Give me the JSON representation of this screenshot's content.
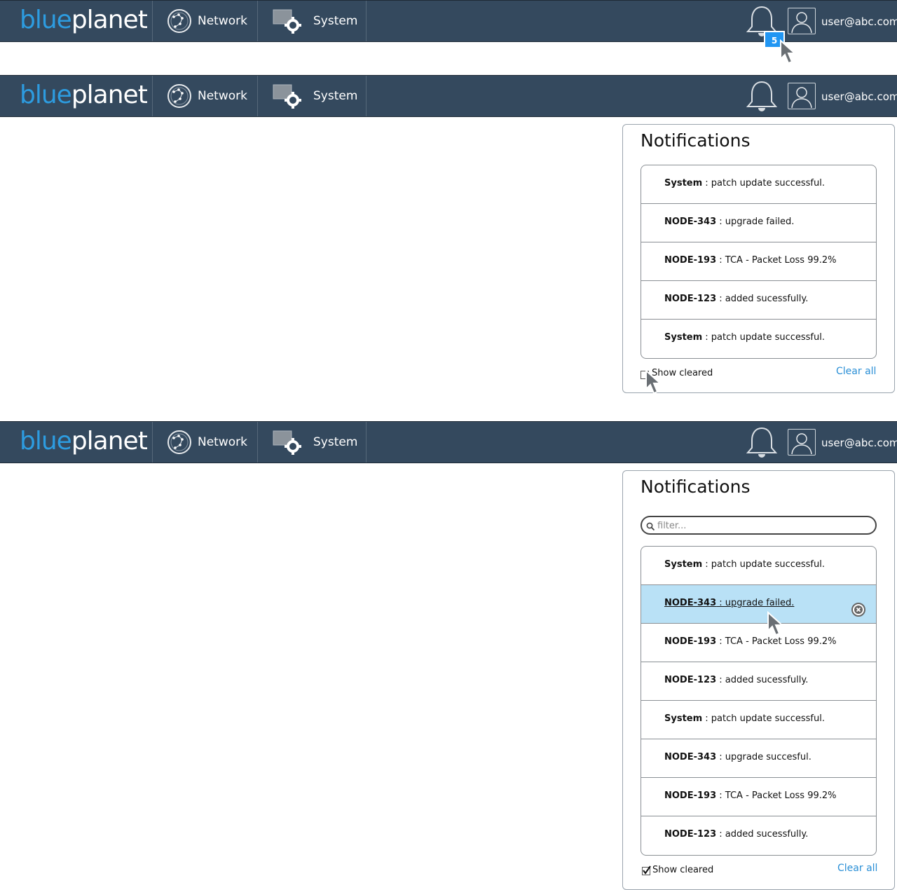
{
  "brand": {
    "part1": "blue",
    "part2": "planet"
  },
  "nav": {
    "network_label": "Network",
    "system_label": "System"
  },
  "user": {
    "email": "user@abc.com"
  },
  "notifications_badge": "5",
  "panel": {
    "title": "Notifications",
    "show_cleared_label": "Show cleared",
    "clear_all_label": "Clear all",
    "filter_placeholder": "filter..."
  },
  "list_short": [
    {
      "source": "System",
      "text": " : patch update successful."
    },
    {
      "source": "NODE-343",
      "text": " : upgrade failed."
    },
    {
      "source": "NODE-193",
      "text": " : TCA - Packet Loss 99.2%"
    },
    {
      "source": "NODE-123",
      "text": " : added sucessfully."
    },
    {
      "source": "System",
      "text": " : patch update successful."
    }
  ],
  "list_full": [
    {
      "source": "System",
      "text": " : patch update successful."
    },
    {
      "source": "NODE-343",
      "text": " : upgrade failed."
    },
    {
      "source": "NODE-193",
      "text": " : TCA - Packet Loss 99.2%"
    },
    {
      "source": "NODE-123",
      "text": " : added sucessfully."
    },
    {
      "source": "System",
      "text": " : patch update successful."
    },
    {
      "source": "NODE-343",
      "text": " : upgrade succesful."
    },
    {
      "source": "NODE-193",
      "text": " : TCA - Packet Loss 99.2%"
    },
    {
      "source": "NODE-123",
      "text": " : added sucessfully."
    }
  ],
  "colors": {
    "navbar": "#34495e",
    "brand_blue": "#2d9ce0",
    "highlight": "#b9e1f6",
    "link": "#2a8fd6",
    "badge": "#2196f3"
  }
}
